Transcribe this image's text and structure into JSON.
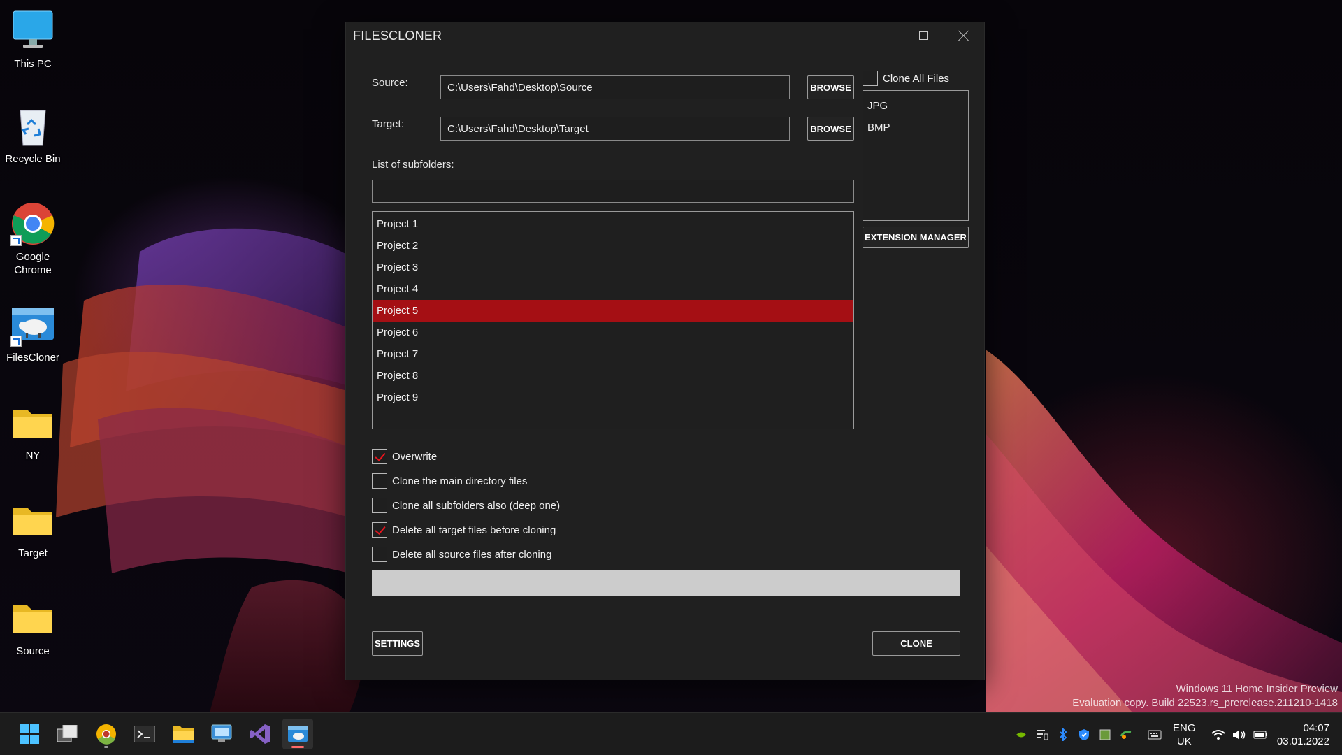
{
  "desktop": {
    "icons": [
      {
        "label": "This PC"
      },
      {
        "label": "Recycle Bin"
      },
      {
        "label": "Google Chrome"
      },
      {
        "label": "FilesCloner"
      },
      {
        "label": "NY"
      },
      {
        "label": "Target"
      },
      {
        "label": "Source"
      }
    ]
  },
  "window": {
    "title": "FILESCLONER",
    "source_label": "Source:",
    "source_value": "C:\\Users\\Fahd\\Desktop\\Source",
    "target_label": "Target:",
    "target_value": "C:\\Users\\Fahd\\Desktop\\Target",
    "browse_label": "BROWSE",
    "subfolders_label": "List of subfolders:",
    "subfolders_filter": "",
    "subfolders": [
      "Project 1",
      "Project 2",
      "Project 3",
      "Project 4",
      "Project 5",
      "Project 6",
      "Project 7",
      "Project 8",
      "Project 9"
    ],
    "selected_subfolder": "Project 5",
    "clone_all_files_label": "Clone All Files",
    "clone_all_files_checked": false,
    "extensions": [
      "JPG",
      "BMP"
    ],
    "extension_manager_label": "EXTENSION MANAGER",
    "options": [
      {
        "label": "Overwrite",
        "checked": true
      },
      {
        "label": "Clone the main directory files",
        "checked": false
      },
      {
        "label": "Clone all subfolders also (deep one)",
        "checked": false
      },
      {
        "label": "Delete all target files before cloning",
        "checked": true
      },
      {
        "label": "Delete all source files after cloning",
        "checked": false
      }
    ],
    "progress": 0,
    "settings_label": "SETTINGS",
    "clone_label": "CLONE",
    "accent_color": "#a50f14",
    "check_color": "#e8141d"
  },
  "watermark": {
    "line1": "Windows 11 Home Insider Preview",
    "line2": "Evaluation copy. Build 22523.rs_prerelease.211210-1418"
  },
  "taskbar": {
    "apps": [
      "start-icon",
      "task-view-icon",
      "chrome-canary-icon",
      "terminal-icon",
      "file-explorer-icon",
      "remote-desktop-icon",
      "visual-studio-icon",
      "filescloner-icon"
    ],
    "lang_line1": "ENG",
    "lang_line2": "UK",
    "time": "04:07",
    "date": "03.01.2022"
  }
}
